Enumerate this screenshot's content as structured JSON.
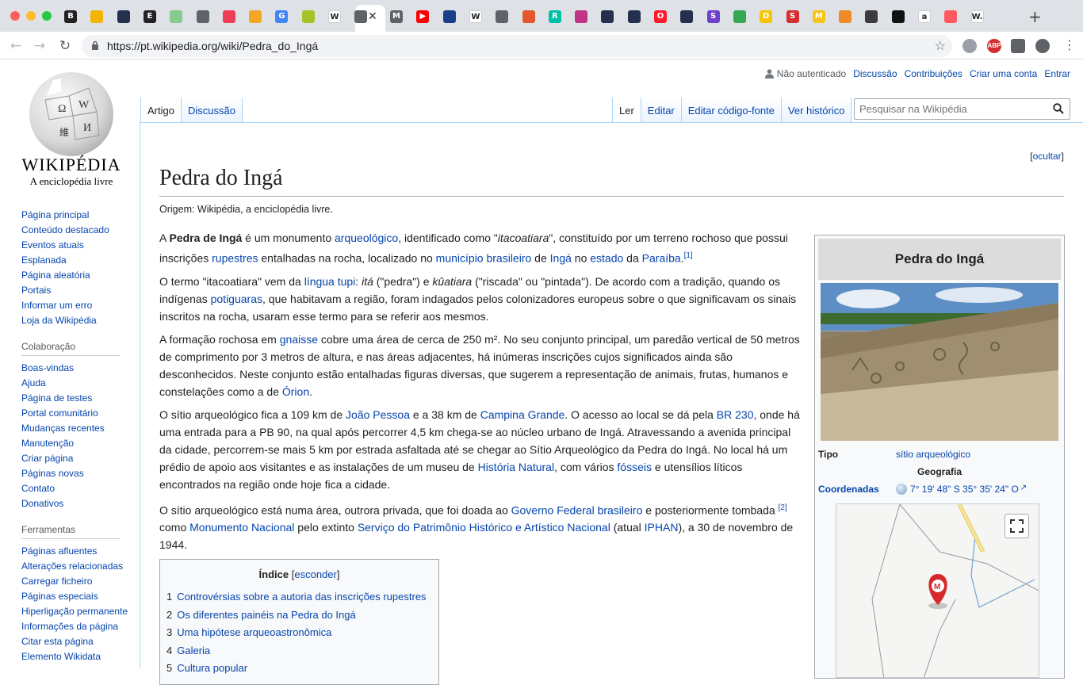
{
  "browser": {
    "url": "https://pt.wikipedia.org/wiki/Pedra_do_Ingá",
    "tabs": [
      {
        "icon": "b-icon",
        "color": "#222222",
        "glyph": "B"
      },
      {
        "icon": "slides-icon",
        "color": "#f4b400",
        "glyph": ""
      },
      {
        "icon": "a-logo-icon",
        "color": "#23304e",
        "glyph": ""
      },
      {
        "icon": "e-icon",
        "color": "#222222",
        "glyph": "E"
      },
      {
        "icon": "sheet-icon",
        "color": "#87c98f",
        "glyph": ""
      },
      {
        "icon": "globe-icon",
        "color": "#5f6368",
        "glyph": ""
      },
      {
        "icon": "pocket-icon",
        "color": "#ef3f56",
        "glyph": ""
      },
      {
        "icon": "cc-icon",
        "color": "#f5a623",
        "glyph": ""
      },
      {
        "icon": "google-icon",
        "color": "#4285f4",
        "glyph": "G"
      },
      {
        "icon": "shield-icon",
        "color": "#a5c324",
        "glyph": ""
      },
      {
        "icon": "wikipedia-icon",
        "color": "#ffffff",
        "glyph": "W"
      },
      {
        "icon": "globe-icon",
        "color": "#5f6368",
        "glyph": ""
      },
      {
        "icon": "m-icon",
        "color": "#5f6368",
        "glyph": "M"
      },
      {
        "icon": "youtube-icon",
        "color": "#ff0000",
        "glyph": "▶"
      },
      {
        "icon": "blue-circle-icon",
        "color": "#1a3f8a",
        "glyph": ""
      },
      {
        "icon": "wikipedia-icon",
        "color": "#ffffff",
        "glyph": "W"
      },
      {
        "icon": "globe-icon",
        "color": "#5f6368",
        "glyph": ""
      },
      {
        "icon": "grid-icon",
        "color": "#e4572e",
        "glyph": ""
      },
      {
        "icon": "r-icon",
        "color": "#00bfa5",
        "glyph": "R"
      },
      {
        "icon": "instagram-icon",
        "color": "#c13584",
        "glyph": ""
      },
      {
        "icon": "a-logo-icon",
        "color": "#23304e",
        "glyph": ""
      },
      {
        "icon": "a-logo-icon",
        "color": "#23304e",
        "glyph": ""
      },
      {
        "icon": "opera-icon",
        "color": "#ff1b2d",
        "glyph": "O"
      },
      {
        "icon": "a-logo-icon",
        "color": "#23304e",
        "glyph": ""
      },
      {
        "icon": "s-icon",
        "color": "#6e40c9",
        "glyph": "S"
      },
      {
        "icon": "drive-icon",
        "color": "#34a853",
        "glyph": ""
      },
      {
        "icon": "d-icon",
        "color": "#f7c600",
        "glyph": "D"
      },
      {
        "icon": "s-red-icon",
        "color": "#d32f2f",
        "glyph": "S"
      },
      {
        "icon": "m-yellow-icon",
        "color": "#f5c518",
        "glyph": "M"
      },
      {
        "icon": "orange-grid-icon",
        "color": "#f08a24",
        "glyph": ""
      },
      {
        "icon": "diamond-icon",
        "color": "#3c3c3c",
        "glyph": ""
      },
      {
        "icon": "black-circle-icon",
        "color": "#111111",
        "glyph": ""
      },
      {
        "icon": "amazon-icon",
        "color": "#ffffff",
        "glyph": "a"
      },
      {
        "icon": "target-icon",
        "color": "#ff5a5f",
        "glyph": ""
      },
      {
        "icon": "w-dot-icon",
        "color": "#ffffff",
        "glyph": "W."
      }
    ]
  },
  "logo": {
    "wordmark": "WIKIPÉDIA",
    "tagline": "A enciclopédia livre"
  },
  "personal": {
    "not_logged": "Não autenticado",
    "links": [
      "Discussão",
      "Contribuições",
      "Criar uma conta",
      "Entrar"
    ]
  },
  "nav_tabs_left": [
    "Artigo",
    "Discussão"
  ],
  "nav_tabs_right": [
    "Ler",
    "Editar",
    "Editar código-fonte",
    "Ver histórico"
  ],
  "search_placeholder": "Pesquisar na Wikipédia",
  "sidebar": {
    "main": [
      "Página principal",
      "Conteúdo destacado",
      "Eventos atuais",
      "Esplanada",
      "Página aleatória",
      "Portais",
      "Informar um erro",
      "Loja da Wikipédia"
    ],
    "collab_heading": "Colaboração",
    "collab": [
      "Boas-vindas",
      "Ajuda",
      "Página de testes",
      "Portal comunitário",
      "Mudanças recentes",
      "Manutenção",
      "Criar página",
      "Páginas novas",
      "Contato",
      "Donativos"
    ],
    "tools_heading": "Ferramentas",
    "tools": [
      "Páginas afluentes",
      "Alterações relacionadas",
      "Carregar ficheiro",
      "Páginas especiais",
      "Hiperligação permanente",
      "Informações da página",
      "Citar esta página",
      "Elemento Wikidata"
    ]
  },
  "article": {
    "hide_link": "ocultar",
    "title": "Pedra do Ingá",
    "site_sub": "Origem: Wikipédia, a enciclopédia livre.",
    "p1": {
      "a": "A ",
      "b": "Pedra de Ingá",
      "c": " é um monumento ",
      "l1": "arqueológico",
      "d": ", identificado como \"",
      "e": "itacoatiara",
      "f": "\", constituído por um terreno rochoso que possui inscrições ",
      "l2": "rupestres",
      "g": " entalhadas na rocha, localizado no ",
      "l3": "município brasileiro",
      "h": " de ",
      "l4": "Ingá",
      "i": " no ",
      "l5": "estado",
      "j": " da ",
      "l6": "Paraíba",
      "k": ".",
      "ref": "[1]"
    },
    "p2": {
      "a": "O termo \"itacoatiara\" vem da ",
      "l1": "língua tupi",
      "b": ": ",
      "c": "itá",
      "d": " (\"pedra\") e ",
      "e": "kûatiara",
      "f": " (\"riscada\" ou \"pintada\"). De acordo com a tradição, quando os indígenas ",
      "l2": "potiguaras",
      "g": ", que habitavam a região, foram indagados pelos colonizadores europeus sobre o que significavam os sinais inscritos na rocha, usaram esse termo para se referir aos mesmos."
    },
    "p3": {
      "a": "A formação rochosa em ",
      "l1": "gnaisse",
      "b": " cobre uma área de cerca de 250 m². No seu conjunto principal, um paredão vertical de 50 metros de comprimento por 3 metros de altura, e nas áreas adjacentes, há inúmeras inscrições cujos significados ainda são desconhecidos. Neste conjunto estão entalhadas figuras diversas, que sugerem a representação de animais, frutas, humanos e constelações como a de ",
      "l2": "Órion",
      "c": "."
    },
    "p4": {
      "a": "O sítio arqueológico fica a 109 km de ",
      "l1": "João Pessoa",
      "b": " e a 38 km de ",
      "l2": "Campina Grande",
      "c": ". O acesso ao local se dá pela ",
      "l3": "BR 230",
      "d": ", onde há uma entrada para a PB 90, na qual após percorrer 4,5 km chega-se ao núcleo urbano de Ingá. Atravessando a avenida principal da cidade, percorrem-se mais 5 km por estrada asfaltada até se chegar ao Sítio Arqueológico da Pedra do Ingá. No local há um prédio de apoio aos visitantes e as instalações de um museu de ",
      "l4": "História Natural",
      "e": ", com vários ",
      "l5": "fósseis",
      "f": " e utensílios líticos encontrados na região onde hoje fica a cidade."
    },
    "p5": {
      "a": "O sítio arqueológico está numa área, outrora privada, que foi doada ao ",
      "l1": "Governo Federal brasileiro",
      "b": " e posteriormente tombada ",
      "ref": "[2]",
      "c": " como ",
      "l2": "Monumento Nacional",
      "d": " pelo extinto ",
      "l3": "Serviço do Patrimônio Histórico e Artístico Nacional",
      "e": " (atual ",
      "l4": "IPHAN",
      "f": "), a 30 de novembro de 1944."
    },
    "toc": {
      "title": "Índice",
      "hide": "esconder",
      "items": [
        {
          "num": "1",
          "label": "Controvérsias sobre a autoria das inscrições rupestres"
        },
        {
          "num": "2",
          "label": "Os diferentes painéis na Pedra do Ingá"
        },
        {
          "num": "3",
          "label": "Uma hipótese arqueoastronômica"
        },
        {
          "num": "4",
          "label": "Galeria"
        },
        {
          "num": "5",
          "label": "Cultura popular"
        }
      ]
    }
  },
  "infobox": {
    "title": "Pedra do Ingá",
    "tipo_label": "Tipo",
    "tipo_value": "sítio arqueológico",
    "geo_heading": "Geografia",
    "coord_label": "Coordenadas",
    "coord_value": "7° 19' 48\" S 35° 35' 24\" O"
  }
}
